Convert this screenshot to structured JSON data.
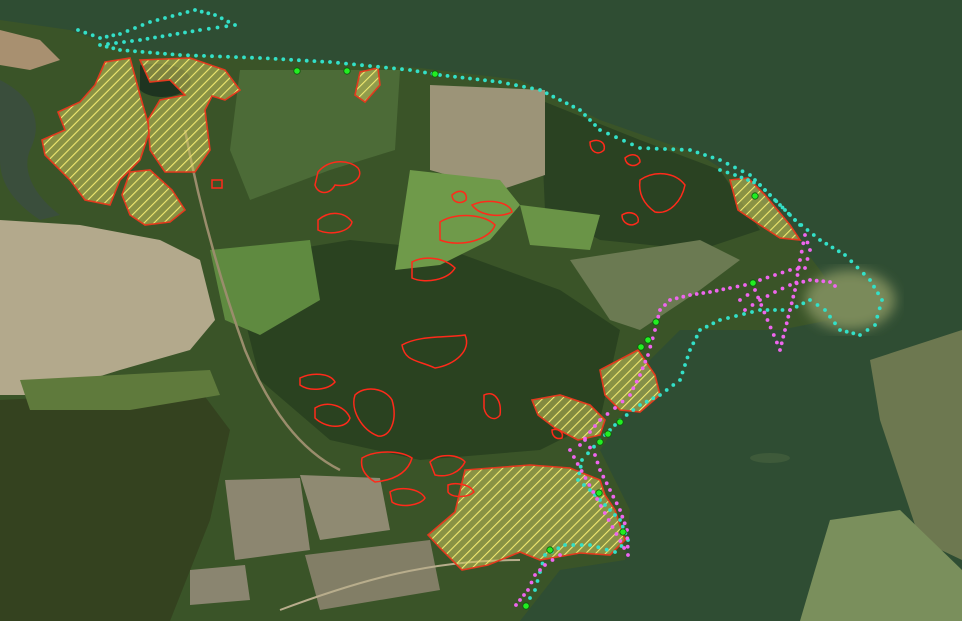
{
  "map": {
    "base": "satellite-imagery",
    "colors": {
      "water": "#2f4d33",
      "water_shallow": "#4a6b45",
      "forest": "#2e4a25",
      "field_green": "#6f9a4c",
      "field_tan": "#b7ad92",
      "shoreline_trace_primary": "#33e0c8",
      "shoreline_trace_secondary": "#ee66ee",
      "hatched_area_outline": "#e33a1e",
      "hatch_fill": "#e8e06a",
      "candidate_outline": "#ff2a1a",
      "sample_point": "#22ee22"
    },
    "layers": [
      {
        "name": "shoreline-trace-primary",
        "symbol": "dotted-line",
        "color": "cyan"
      },
      {
        "name": "shoreline-trace-secondary",
        "symbol": "dotted-line",
        "color": "magenta"
      },
      {
        "name": "hatched-areas",
        "symbol": "diagonal-hatch-polygon",
        "color": "yellow/red"
      },
      {
        "name": "outlined-areas",
        "symbol": "red-outline-polygon",
        "color": "red"
      },
      {
        "name": "sample-points",
        "symbol": "dot",
        "color": "green"
      }
    ]
  }
}
